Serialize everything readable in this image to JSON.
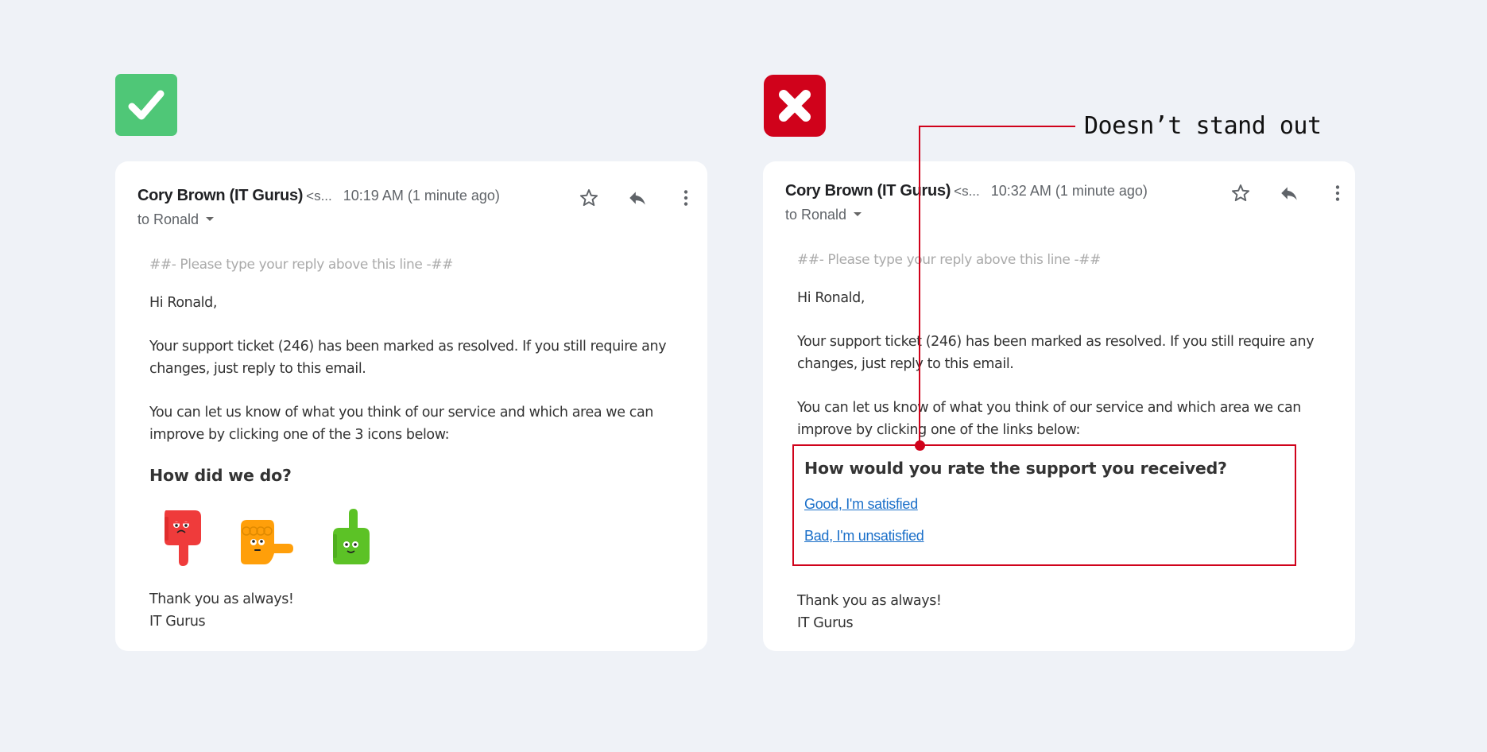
{
  "colors": {
    "background": "#eff2f7",
    "good": "#4fc777",
    "bad": "#d0021b",
    "link": "#1a6fc9"
  },
  "good_example": {
    "badge_icon": "checkmark-icon",
    "email": {
      "sender_name": "Cory Brown (IT Gurus)",
      "sender_address": "<s...",
      "timestamp": "10:19 AM (1 minute ago)",
      "to": "to Ronald",
      "reply_line": "##- Please type your reply above this line -##",
      "greeting": "Hi Ronald,",
      "paragraph1": "Your support ticket (246) has been marked as resolved. If you still require any changes, just reply to this email.",
      "paragraph2": "You can let us know of what you think of our service and which area we can improve by clicking one of the 3 icons below:",
      "question": "How did we do?",
      "rating_icons": [
        "thumbs-down-icon",
        "neutral-hand-icon",
        "thumbs-up-icon"
      ],
      "signoff_line1": "Thank you as always!",
      "signoff_line2": "IT Gurus"
    }
  },
  "bad_example": {
    "badge_icon": "x-mark-icon",
    "annotation": "Doesn’t stand out",
    "email": {
      "sender_name": "Cory Brown (IT Gurus)",
      "sender_address": "<s...",
      "timestamp": "10:32 AM (1 minute ago)",
      "to": "to Ronald",
      "reply_line": "##- Please type your reply above this line -##",
      "greeting": "Hi Ronald,",
      "paragraph1": "Your support ticket (246) has been marked as resolved. If you still require any changes, just reply to this email.",
      "paragraph2": "You can let us know of what you think of our service and which area we can improve by clicking one of the links below:",
      "question": "How would you rate the support you received?",
      "link_good": "Good, I'm satisfied",
      "link_bad": "Bad, I'm unsatisfied",
      "signoff_line1": "Thank you as always!",
      "signoff_line2": "IT Gurus"
    }
  }
}
